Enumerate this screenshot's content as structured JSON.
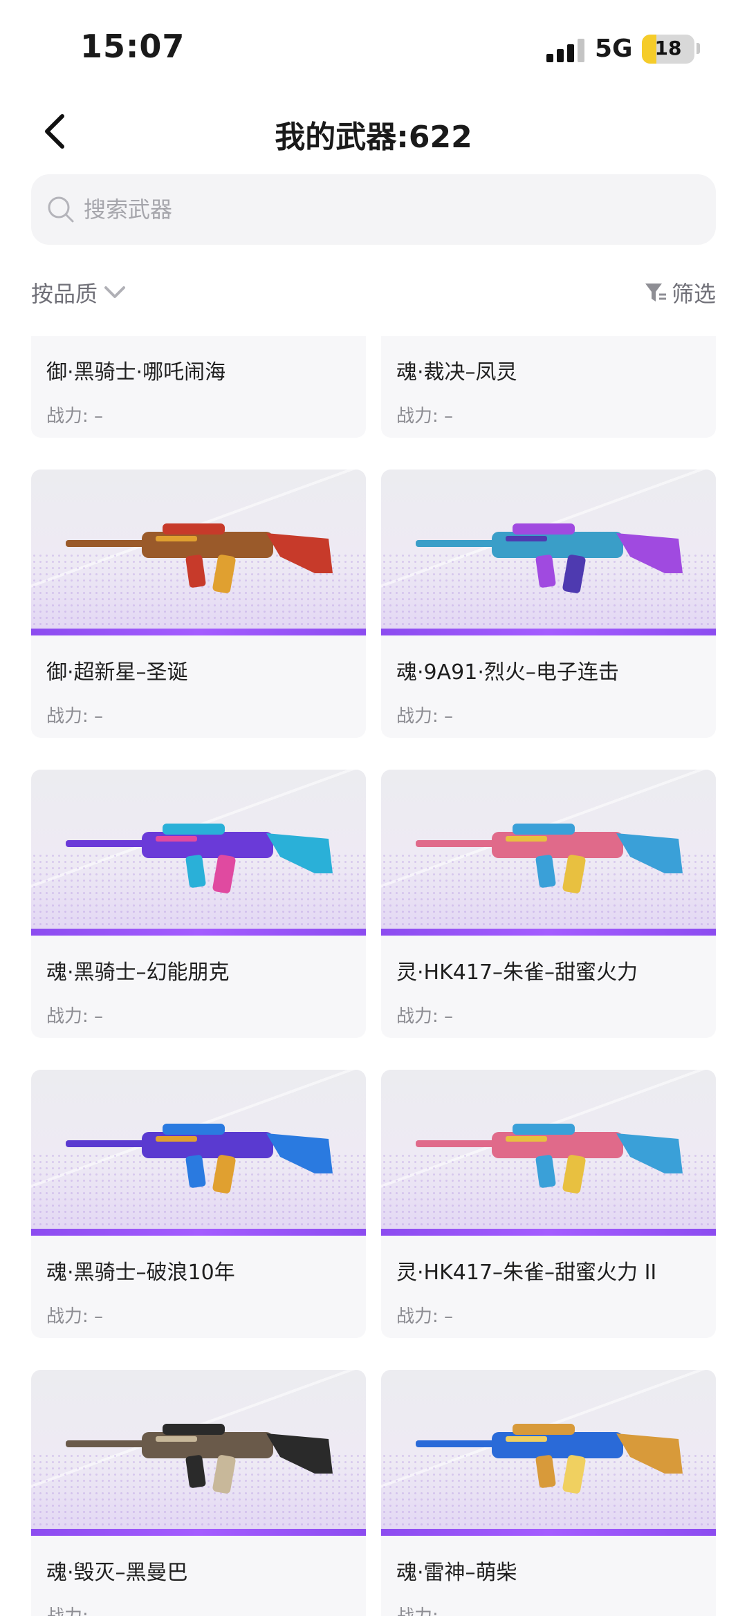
{
  "status_bar": {
    "time": "15:07",
    "network": "5G",
    "battery": "18"
  },
  "header": {
    "title": "我的武器:622"
  },
  "search": {
    "placeholder": "搜索武器"
  },
  "filters": {
    "sort_label": "按品质",
    "filter_label": "筛选"
  },
  "weapons": [
    {
      "name": "御·黑骑士·哪吒闹海",
      "power": "战力: –",
      "colors": [
        "#b03a2e",
        "#1b1b26",
        "#d4a24c"
      ]
    },
    {
      "name": "魂·裁决–凤灵",
      "power": "战力: –",
      "colors": [
        "#3e6bd8",
        "#8d4ce8",
        "#f0c040"
      ]
    },
    {
      "name": "御·超新星–圣诞",
      "power": "战力: –",
      "colors": [
        "#9a5a2a",
        "#c73a2a",
        "#e0a030"
      ]
    },
    {
      "name": "魂·9A91·烈火–电子连击",
      "power": "战力: –",
      "colors": [
        "#3a9ec8",
        "#a04ae0",
        "#4e3ab0"
      ]
    },
    {
      "name": "魂·黑骑士–幻能朋克",
      "power": "战力: –",
      "colors": [
        "#6a3ad8",
        "#2ab0d8",
        "#e04aa0"
      ]
    },
    {
      "name": "灵·HK417–朱雀–甜蜜火力",
      "power": "战力: –",
      "colors": [
        "#e06a8a",
        "#3aa0d8",
        "#e8c040"
      ]
    },
    {
      "name": "魂·黑骑士–破浪10年",
      "power": "战力: –",
      "colors": [
        "#5a3ad0",
        "#2a7ae0",
        "#e0a030"
      ]
    },
    {
      "name": "灵·HK417–朱雀–甜蜜火力 II",
      "power": "战力: –",
      "colors": [
        "#e06a8a",
        "#3aa0d8",
        "#e8c040"
      ]
    },
    {
      "name": "魂·毁灭–黑曼巴",
      "power": "战力: –",
      "colors": [
        "#6a5a4a",
        "#2a2a2a",
        "#c8b89a"
      ]
    },
    {
      "name": "魂·雷神–萌柴",
      "power": "战力: –",
      "colors": [
        "#2a6ad8",
        "#d89a3a",
        "#f0d060"
      ]
    }
  ]
}
